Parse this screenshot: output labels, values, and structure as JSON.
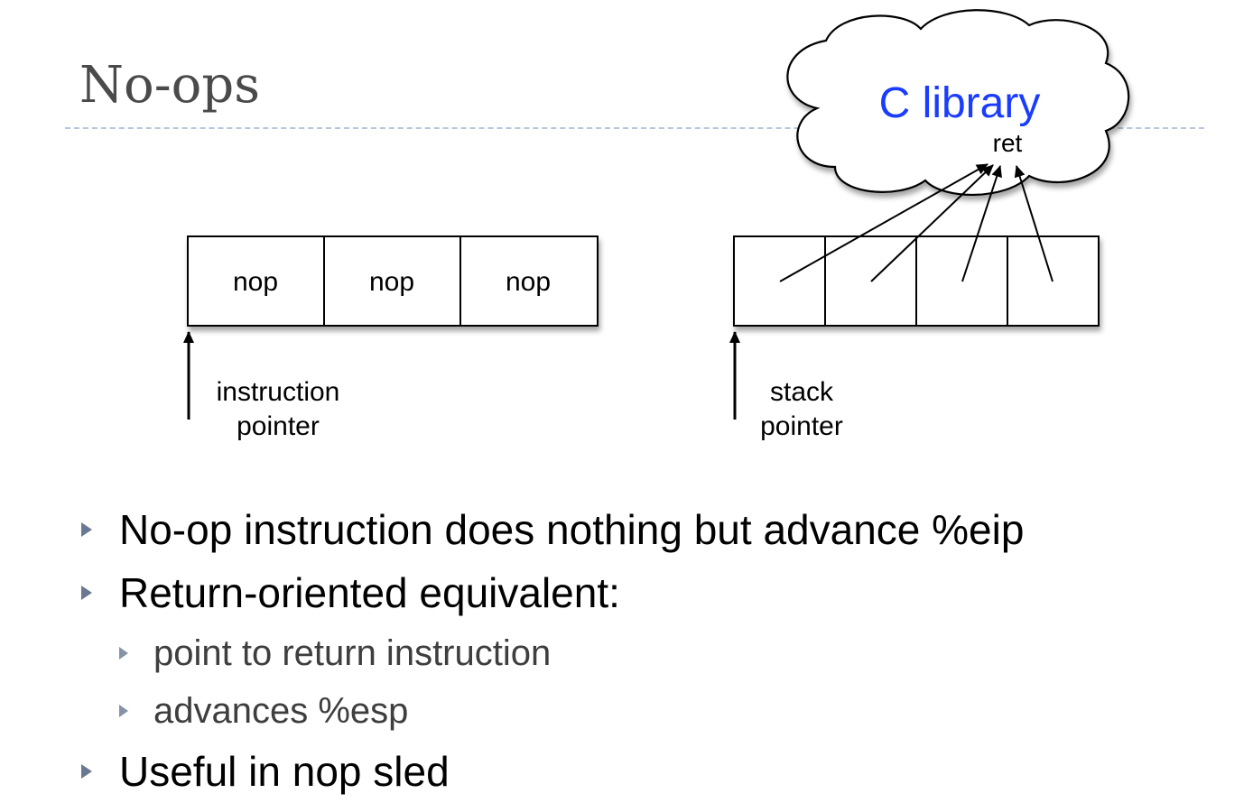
{
  "title": "No-ops",
  "diagram": {
    "cloud_label": "C library",
    "ret_label": "ret",
    "nop_cells": [
      "nop",
      "nop",
      "nop"
    ],
    "instruction_pointer": [
      "instruction",
      "pointer"
    ],
    "stack_pointer": [
      "stack",
      "pointer"
    ],
    "colors": {
      "cloud_label": "#1a3cff",
      "stroke": "#000000"
    }
  },
  "bullets": [
    {
      "level": 1,
      "text": "No-op instruction does nothing but advance %eip"
    },
    {
      "level": 1,
      "text": "Return-oriented equivalent:"
    },
    {
      "level": 2,
      "text": "point to return instruction"
    },
    {
      "level": 2,
      "text": "advances %esp"
    },
    {
      "level": 1,
      "text": "Useful in nop sled"
    }
  ]
}
